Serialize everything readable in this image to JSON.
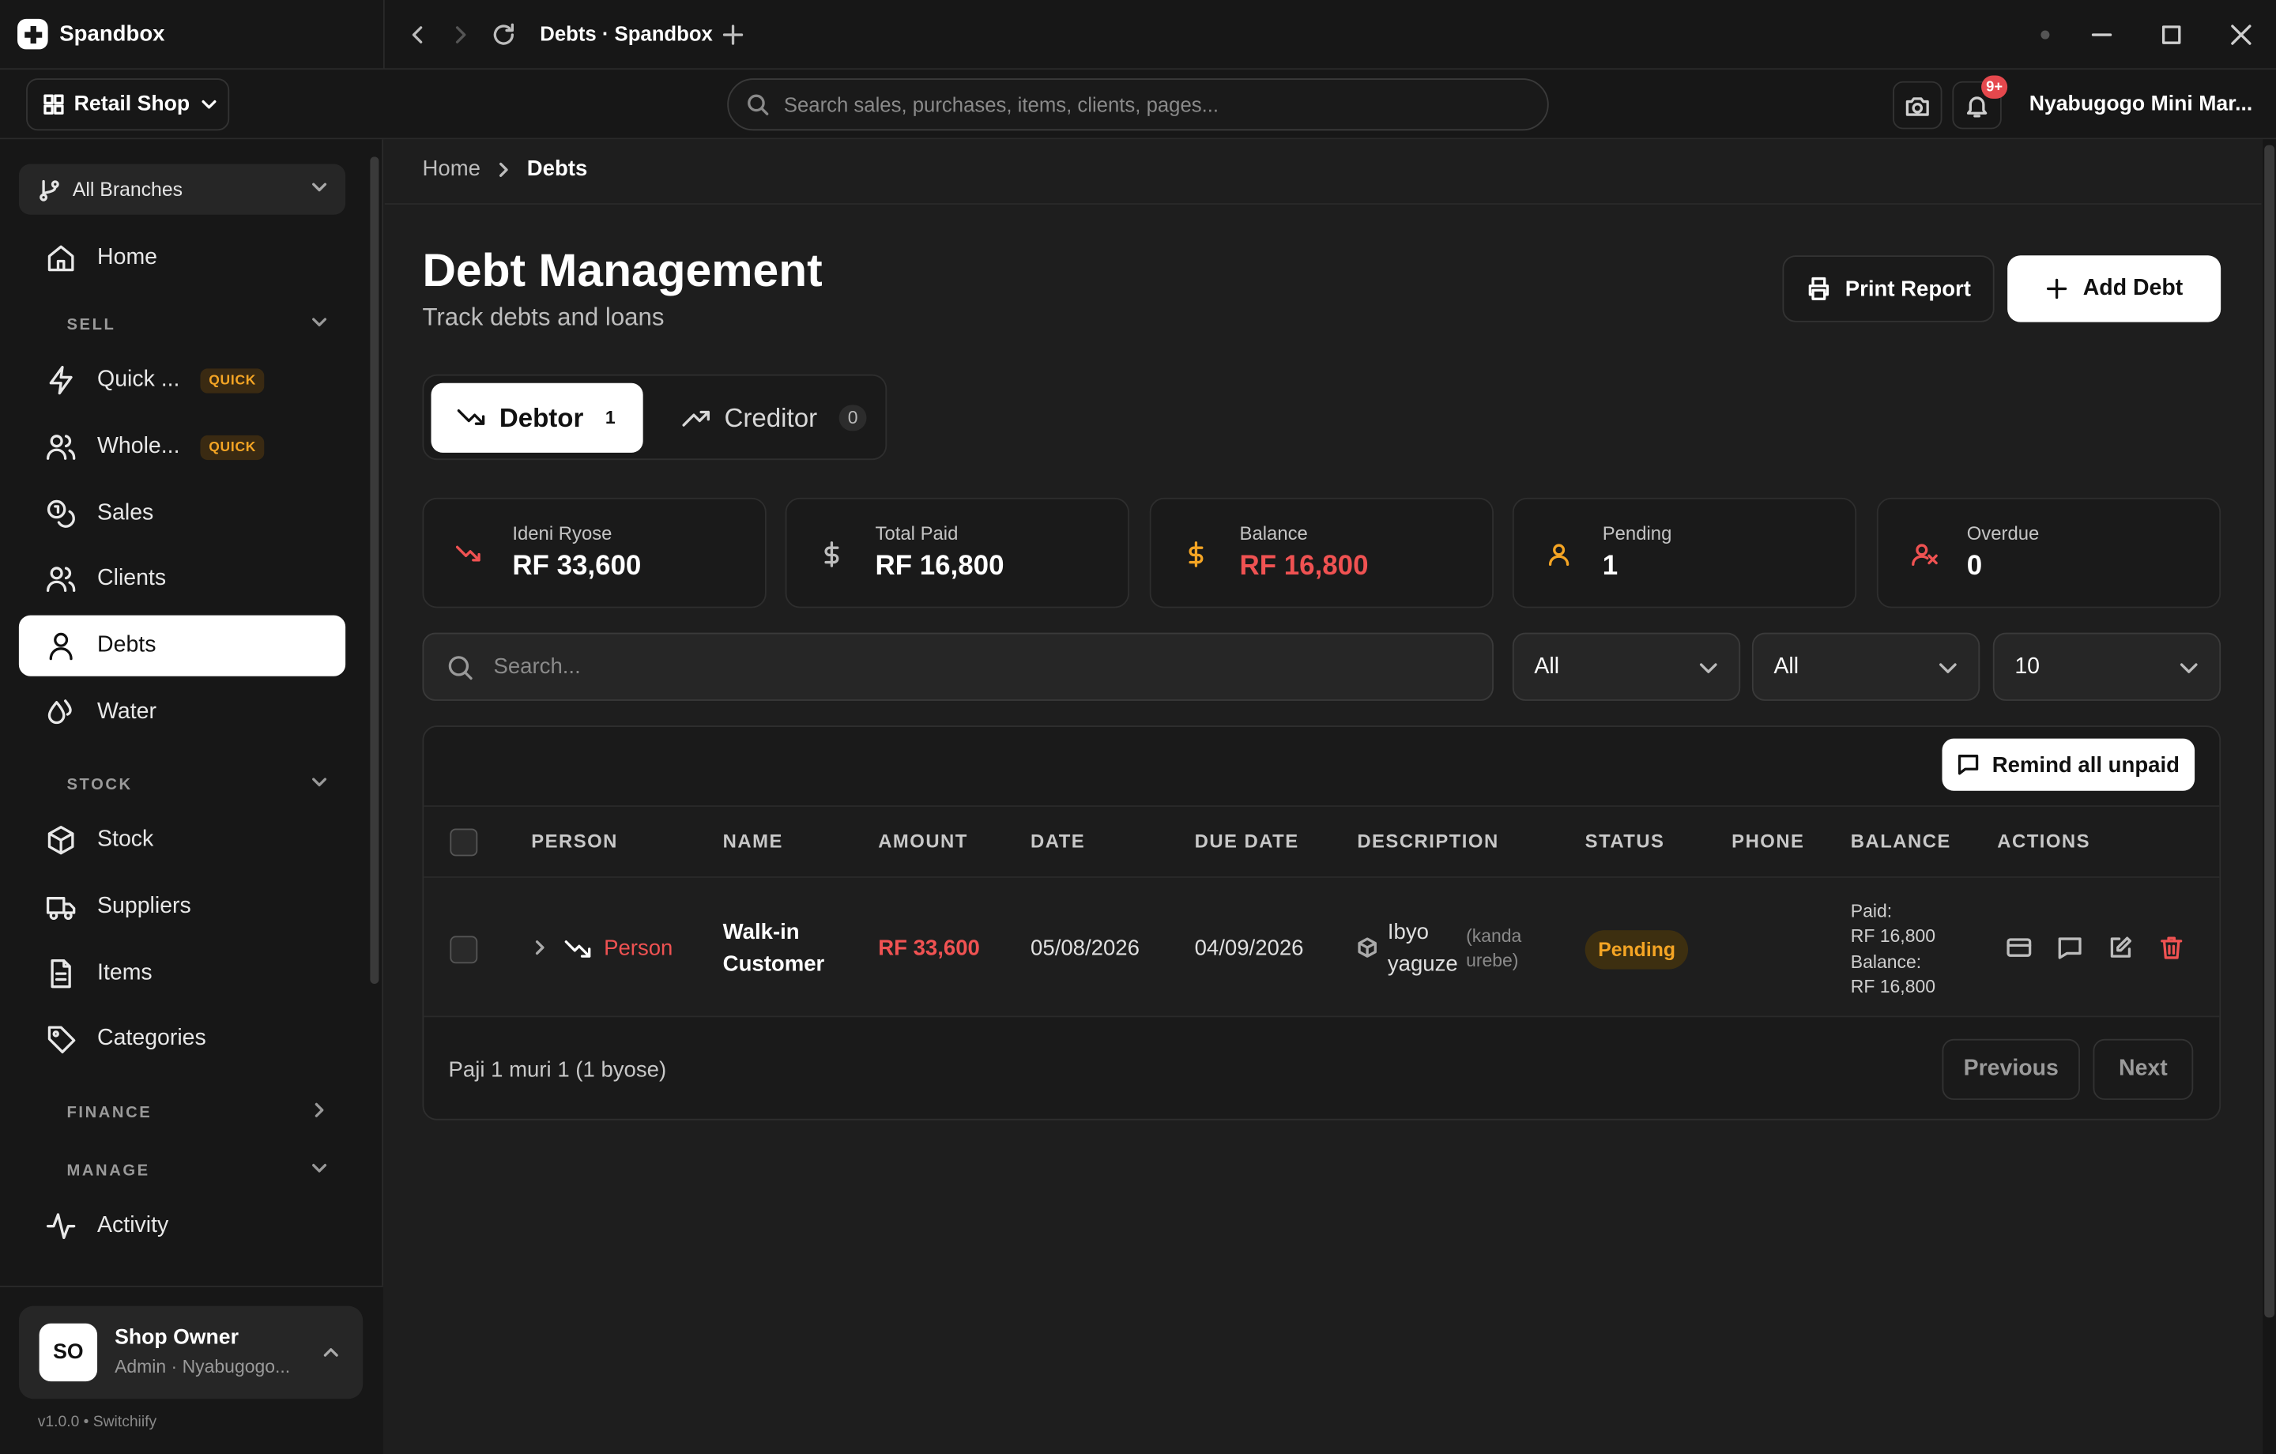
{
  "app": {
    "name": "Spandbox",
    "tab_title": "Debts · Spandbox"
  },
  "header": {
    "shop_selector": "Retail Shop",
    "search_placeholder": "Search sales, purchases, items, clients, pages...",
    "notif_badge": "9+",
    "org_name": "Nyabugogo Mini Mar..."
  },
  "sidebar": {
    "branch": "All Branches",
    "items": {
      "home": "Home",
      "quick": "Quick ...",
      "wholesale": "Whole...",
      "sales": "Sales",
      "clients": "Clients",
      "debts": "Debts",
      "water": "Water",
      "stock": "Stock",
      "suppliers": "Suppliers",
      "items": "Items",
      "categories": "Categories",
      "activity": "Activity"
    },
    "badge_quick": "QUICK",
    "sections": {
      "sell": "SELL",
      "stock": "STOCK",
      "finance": "FINANCE",
      "manage": "MANAGE"
    },
    "user": {
      "initials": "SO",
      "name": "Shop Owner",
      "role": "Admin · Nyabugogo..."
    },
    "version": "v1.0.0 • Switchiify"
  },
  "breadcrumb": {
    "home": "Home",
    "current": "Debts"
  },
  "page": {
    "title": "Debt Management",
    "subtitle": "Track debts and loans",
    "print_label": "Print Report",
    "add_label": "Add Debt",
    "toggle": {
      "debtor": "Debtor",
      "debtor_count": "1",
      "creditor": "Creditor",
      "creditor_count": "0"
    }
  },
  "stats": [
    {
      "label": "Ideni Ryose",
      "value": "RF 33,600"
    },
    {
      "label": "Total Paid",
      "value": "RF 16,800"
    },
    {
      "label": "Balance",
      "value": "RF 16,800"
    },
    {
      "label": "Pending",
      "value": "1"
    },
    {
      "label": "Overdue",
      "value": "0"
    }
  ],
  "colors": {
    "accent_red": "#f05252",
    "accent_amber": "#f5a524",
    "surface": "#1a1a1a"
  },
  "filters": {
    "search_placeholder": "Search...",
    "select1": "All",
    "select2": "All",
    "page_size": "10"
  },
  "table": {
    "remind_label": "Remind all unpaid",
    "columns": [
      "PERSON",
      "NAME",
      "AMOUNT",
      "DATE",
      "DUE DATE",
      "DESCRIPTION",
      "STATUS",
      "PHONE",
      "BALANCE",
      "ACTIONS"
    ],
    "rows": [
      {
        "person": "Person",
        "name_line1": "Walk-in",
        "name_line2": "Customer",
        "amount": "RF 33,600",
        "date": "05/08/2026",
        "due_date": "04/09/2026",
        "desc_line1": "Ibyo",
        "desc_line2": "yaguze",
        "desc_note1": "(kanda",
        "desc_note2": "urebe)",
        "status": "Pending",
        "phone": "",
        "bal_paid_label": "Paid:",
        "bal_paid": "RF 16,800",
        "bal_label": "Balance:",
        "bal_value": "RF 16,800"
      }
    ],
    "page_info": "Paji 1 muri 1 (1 byose)",
    "prev_label": "Previous",
    "next_label": "Next"
  }
}
